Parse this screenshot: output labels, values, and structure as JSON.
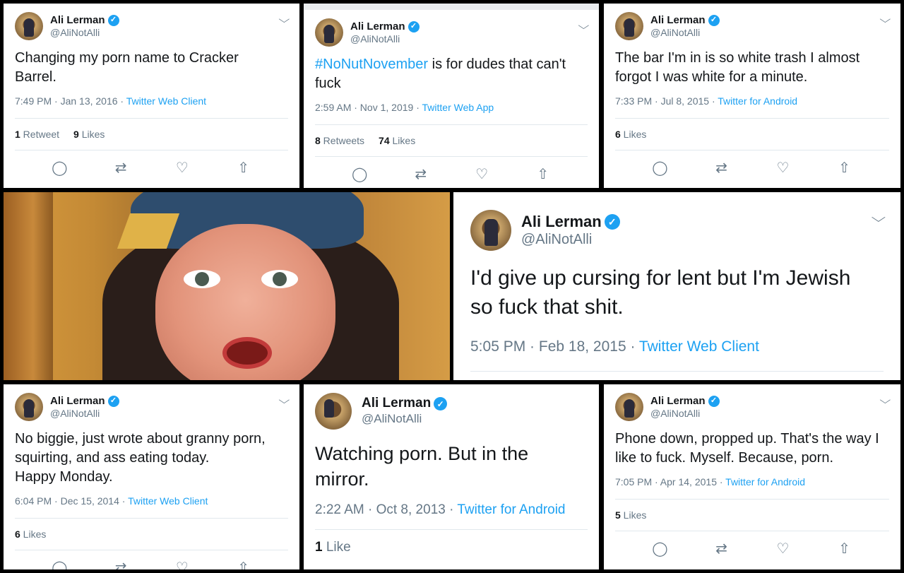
{
  "author": {
    "name": "Ali Lerman",
    "handle": "@AliNotAlli",
    "verified_glyph": "✓"
  },
  "icons": {
    "chevron": "chevron-down-icon",
    "reply": "reply-icon",
    "retweet": "retweet-icon",
    "like": "heart-icon",
    "share": "share-icon"
  },
  "glyphs": {
    "chevron": "⌵",
    "reply": "◯",
    "retweet": "⇄",
    "like": "♡",
    "share": "⇧"
  },
  "tweets": [
    {
      "text": "Changing my porn name to Cracker\nBarrel.",
      "time": "7:49 PM · Jan 13, 2016 · ",
      "source": "Twitter Web Client",
      "stat1_num": "1",
      "stat1_label": " Retweet",
      "stat2_num": "9",
      "stat2_label": " Likes"
    },
    {
      "hashtag": "#NoNutNovember",
      "text": " is for dudes that can't\nfuck",
      "time": "2:59 AM · Nov 1, 2019 · ",
      "source": "Twitter Web App",
      "stat1_num": "8",
      "stat1_label": " Retweets",
      "stat2_num": "74",
      "stat2_label": " Likes"
    },
    {
      "text": "The bar I'm in is so white trash I almost\nforgot I was white for a minute.",
      "time": "7:33 PM · Jul 8, 2015 · ",
      "source": "Twitter for Android",
      "stat1_num": "6",
      "stat1_label": " Likes"
    },
    {
      "text": "I'd give up cursing for lent but I'm Jewish\nso fuck that shit.",
      "time": "5:05 PM · Feb 18, 2015 · ",
      "source": "Twitter Web Client"
    },
    {
      "text": "No biggie, just wrote about granny porn,\nsquirting, and ass eating today.\nHappy Monday.",
      "time": "6:04 PM · Dec 15, 2014 · ",
      "source": "Twitter Web Client",
      "stat1_num": "6",
      "stat1_label": " Likes"
    },
    {
      "text": "Watching porn. But in the mirror.",
      "time": "2:22 AM · Oct 8, 2013 · ",
      "source": "Twitter for Android",
      "stat1_num": "1",
      "stat1_label": " Like"
    },
    {
      "text": "Phone down, propped up. That's the way I\nlike to fuck. Myself. Because, porn.",
      "time": "7:05 PM · Apr 14, 2015 · ",
      "source": "Twitter for Android",
      "stat1_num": "5",
      "stat1_label": " Likes"
    }
  ]
}
